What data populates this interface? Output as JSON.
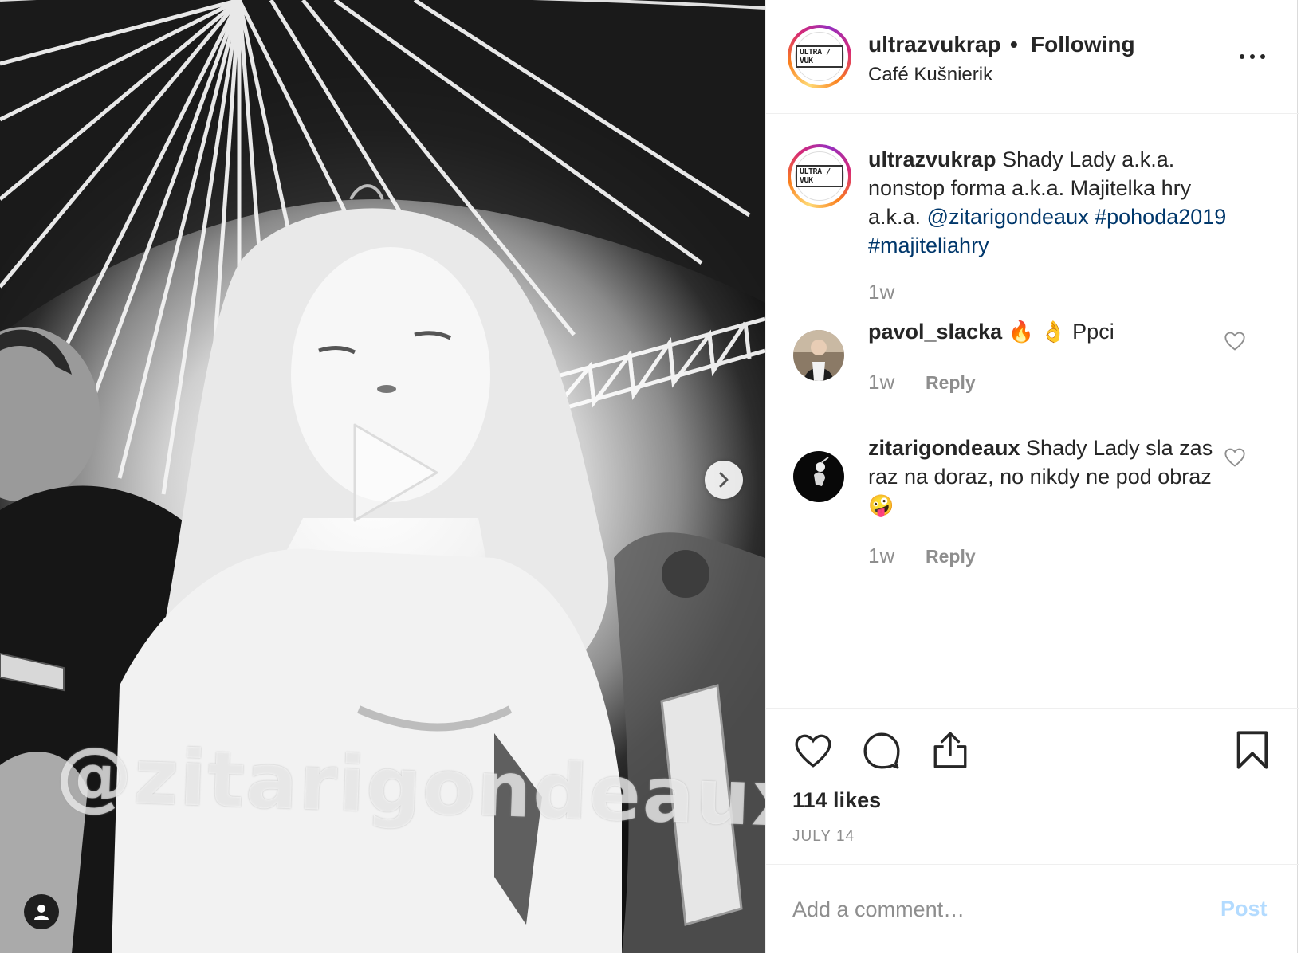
{
  "post": {
    "username": "ultrazvukrap",
    "separator": "•",
    "follow_status": "Following",
    "location": "Café Kušnierik",
    "avatar_logo_text": "ULTRA / VUK",
    "media": {
      "watermark_text": "@zitarigondeaux",
      "type": "video"
    },
    "caption": {
      "username": "ultrazvukrap",
      "text": "Shady Lady a.k.a. nonstop forma a.k.a. Majitelka hry a.k.a.",
      "mention": "@zitarigondeaux",
      "hashtag_1": "#pohoda2019",
      "hashtag_2": "#majiteliahry",
      "time": "1w"
    },
    "comments": [
      {
        "username": "pavol_slacka",
        "emoji": "🔥 👌",
        "text": "Ppci",
        "time": "1w",
        "reply_label": "Reply"
      },
      {
        "username": "zitarigondeaux",
        "text": "Shady Lady sla zas raz na doraz, no nikdy ne pod obraz",
        "emoji": "🤪",
        "time": "1w",
        "reply_label": "Reply"
      }
    ],
    "likes": "114 likes",
    "date": "JULY 14",
    "comment_placeholder": "Add a comment…",
    "post_label": "Post"
  },
  "colors": {
    "link": "#00376b",
    "secondary_text": "#8e8e8e",
    "post_disabled": "#b3dbff",
    "border": "#efefef"
  }
}
